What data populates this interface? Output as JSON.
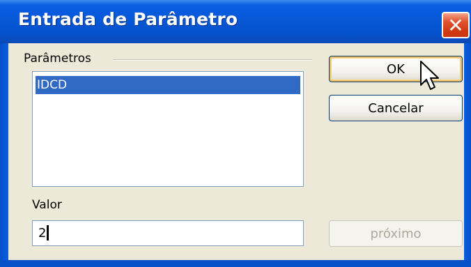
{
  "window": {
    "title": "Entrada de Parâmetro",
    "close_symbol": "✕"
  },
  "parameters_group": {
    "label": "Parâmetros",
    "items": [
      "IDCD"
    ],
    "selected_index": 0
  },
  "value_field": {
    "label": "Valor",
    "value": "2"
  },
  "buttons": {
    "ok": "OK",
    "cancel": "Cancelar",
    "next": "próximo"
  },
  "colors": {
    "titlebar": "#0757d6",
    "selection": "#316ac5",
    "dialog_face": "#ece9d8",
    "close_button": "#d23c16"
  }
}
